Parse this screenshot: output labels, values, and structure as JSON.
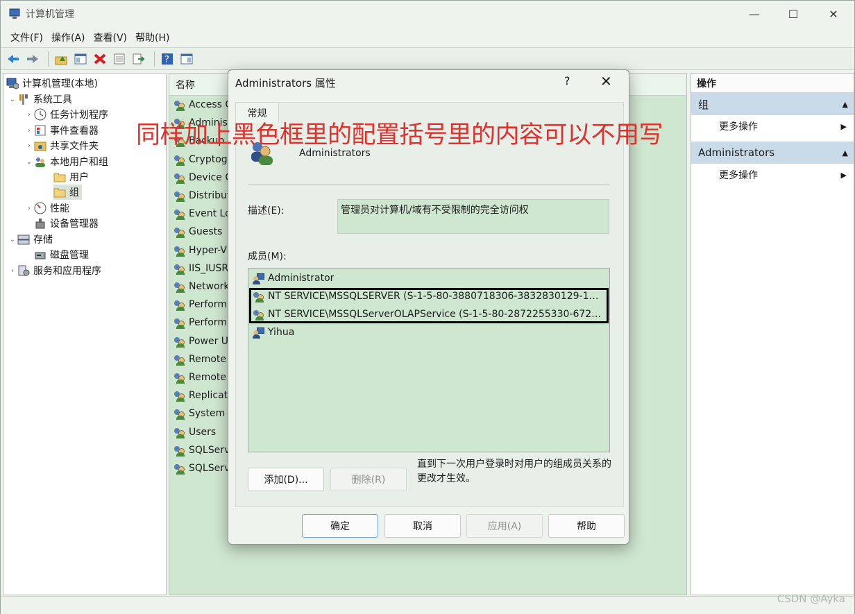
{
  "window": {
    "title": "计算机管理",
    "controls": {
      "minimize": "—",
      "maximize": "☐",
      "close": "✕"
    }
  },
  "menu": [
    "文件(F)",
    "操作(A)",
    "查看(V)",
    "帮助(H)"
  ],
  "toolbar": {
    "icons": [
      "back-icon",
      "forward-icon",
      "up-folder-icon",
      "show-hide-tree-icon",
      "delete-icon",
      "properties-icon",
      "export-icon",
      "help-icon",
      "show-hide-action-icon"
    ]
  },
  "tree": {
    "root": "计算机管理(本地)",
    "items": [
      {
        "label": "系统工具",
        "expander": "⌄"
      },
      {
        "label": "任务计划程序",
        "expander": "›"
      },
      {
        "label": "事件查看器",
        "expander": "›"
      },
      {
        "label": "共享文件夹",
        "expander": "›"
      },
      {
        "label": "本地用户和组",
        "expander": "⌄"
      },
      {
        "label": "用户",
        "expander": ""
      },
      {
        "label": "组",
        "expander": ""
      },
      {
        "label": "性能",
        "expander": "›"
      },
      {
        "label": "设备管理器",
        "expander": ""
      },
      {
        "label": "存储",
        "expander": "⌄"
      },
      {
        "label": "磁盘管理",
        "expander": ""
      },
      {
        "label": "服务和应用程序",
        "expander": "›"
      }
    ]
  },
  "list": {
    "header": "名称",
    "rows": [
      "Access C",
      "Adminis",
      "Backup",
      "Cryptogr",
      "Device C",
      "Distribut",
      "Event Lo",
      "Guests",
      "Hyper-V",
      "IIS_IUSR",
      "Network",
      "Perform",
      "Perform",
      "Power U",
      "Remote",
      "Remote",
      "Replicat",
      "System I",
      "Users",
      "SQLServ",
      "SQLServ"
    ]
  },
  "actions": {
    "header": "操作",
    "sections": [
      {
        "title": "组",
        "item": "更多操作"
      },
      {
        "title": "Administrators",
        "item": "更多操作"
      }
    ]
  },
  "dialog": {
    "title": "Administrators 属性",
    "help": "?",
    "close": "✕",
    "tab": "常规",
    "group_name": "Administrators",
    "desc_label": "描述(E):",
    "desc_value": "管理员对计算机/域有不受限制的完全访问权",
    "members_label": "成员(M):",
    "members": [
      "Administrator",
      "NT SERVICE\\MSSQLSERVER (S-1-5-80-3880718306-3832830129-1…",
      "NT SERVICE\\MSSQLServerOLAPService (S-1-5-80-2872255330-672…",
      "Yihua"
    ],
    "add_button": "添加(D)...",
    "remove_button": "删除(R)",
    "note": "直到下一次用户登录时对用户的组成员关系的更改才生效。",
    "ok_button": "确定",
    "cancel_button": "取消",
    "apply_button": "应用(A)",
    "help_button": "帮助"
  },
  "annotation": "同样加上黑色框里的配置括号里的内容可以不用写",
  "watermark": "CSDN @Ayka"
}
